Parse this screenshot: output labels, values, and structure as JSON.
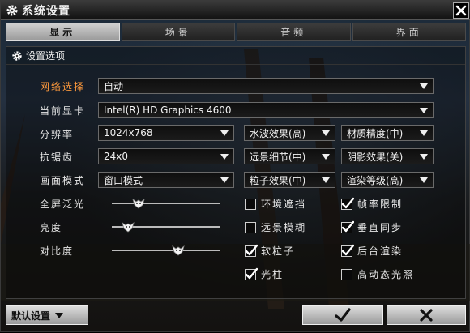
{
  "window": {
    "title": "系统设置"
  },
  "tabs": [
    {
      "label": "显示",
      "active": true
    },
    {
      "label": "场景",
      "active": false
    },
    {
      "label": "音频",
      "active": false
    },
    {
      "label": "界面",
      "active": false
    }
  ],
  "panel": {
    "title": "设置选项"
  },
  "rows": {
    "network": {
      "label": "网络选择",
      "value": "自动"
    },
    "gpu": {
      "label": "当前显卡",
      "value": "Intel(R) HD Graphics 4600"
    },
    "resolution": {
      "label": "分辨率",
      "value": "1024x768"
    },
    "antialias": {
      "label": "抗锯齿",
      "value": "24x0"
    },
    "display_mode": {
      "label": "画面模式",
      "value": "窗口模式"
    },
    "bloom": {
      "label": "全屏泛光",
      "level": 0.25
    },
    "brightness": {
      "label": "亮度",
      "level": 0.15
    },
    "contrast": {
      "label": "对比度",
      "level": 0.62
    }
  },
  "quality": {
    "water": "水波效果(高)",
    "texture": "材质精度(中)",
    "distance": "远景细节(中)",
    "shadow": "阴影效果(关)",
    "particles": "粒子效果(中)",
    "render": "渲染等级(高)"
  },
  "checks": {
    "ao": {
      "label": "环境遮挡",
      "checked": false
    },
    "frame_limit": {
      "label": "帧率限制",
      "checked": true
    },
    "dof": {
      "label": "远景模糊",
      "checked": false
    },
    "vsync": {
      "label": "垂直同步",
      "checked": true
    },
    "soft_particles": {
      "label": "软粒子",
      "checked": true
    },
    "bg_render": {
      "label": "后台渲染",
      "checked": true
    },
    "light_shafts": {
      "label": "光柱",
      "checked": true
    },
    "hdr": {
      "label": "高动态光照",
      "checked": false
    }
  },
  "footer": {
    "defaults_label": "默认设置"
  }
}
